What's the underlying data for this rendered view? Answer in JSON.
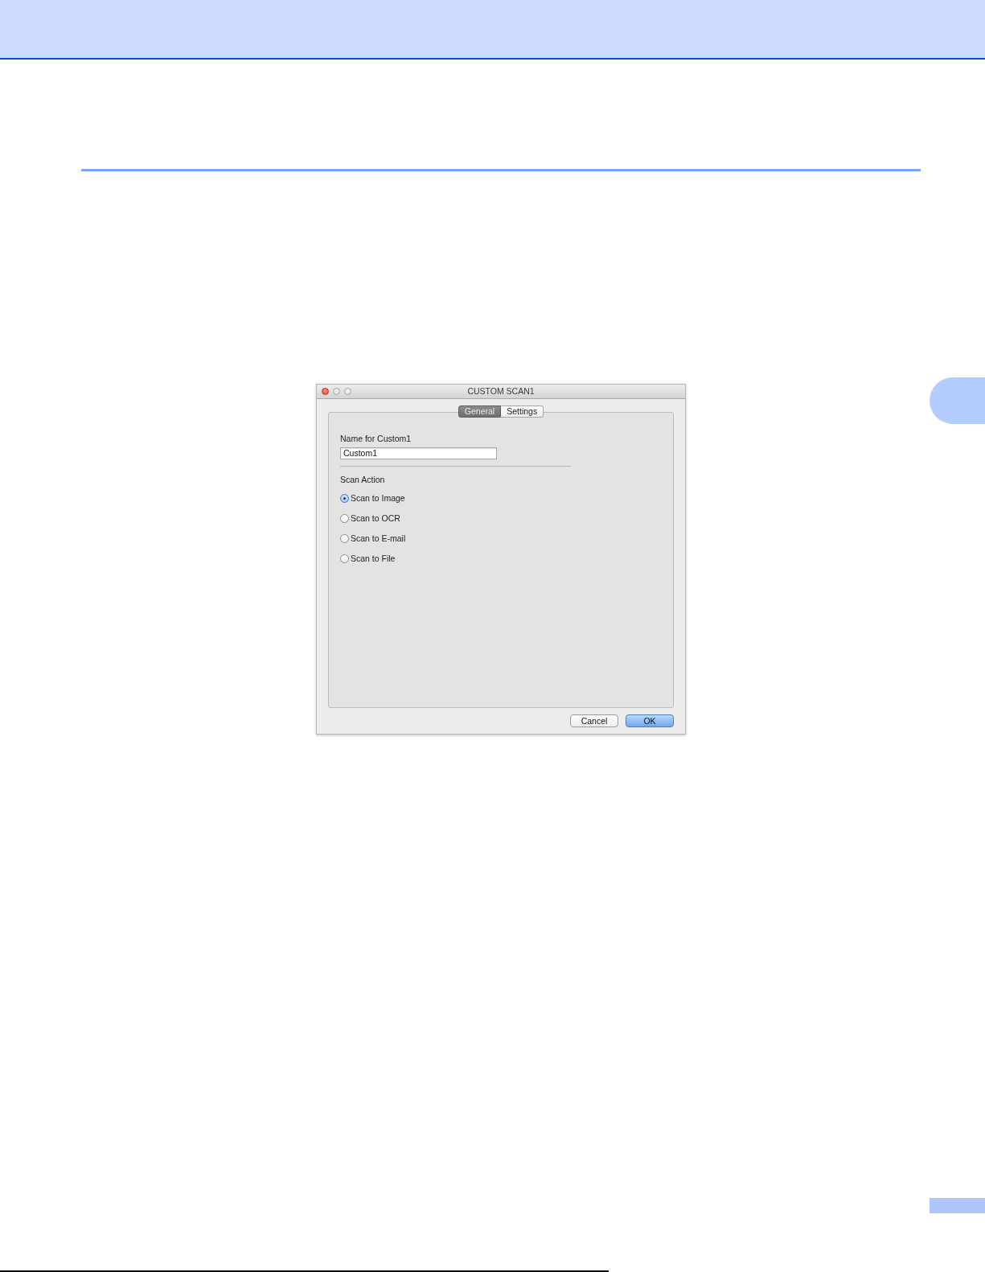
{
  "window": {
    "title": "CUSTOM SCAN1"
  },
  "tabs": [
    {
      "label": "General",
      "selected": true
    },
    {
      "label": "Settings",
      "selected": false
    }
  ],
  "name_field": {
    "label": "Name for Custom1",
    "value": "Custom1"
  },
  "scan_action": {
    "label": "Scan Action",
    "options": [
      {
        "label": "Scan to Image",
        "selected": true
      },
      {
        "label": "Scan to OCR",
        "selected": false
      },
      {
        "label": "Scan to E-mail",
        "selected": false
      },
      {
        "label": "Scan to File",
        "selected": false
      }
    ]
  },
  "buttons": [
    {
      "label": "Cancel",
      "kind": "normal"
    },
    {
      "label": "OK",
      "kind": "default"
    }
  ]
}
